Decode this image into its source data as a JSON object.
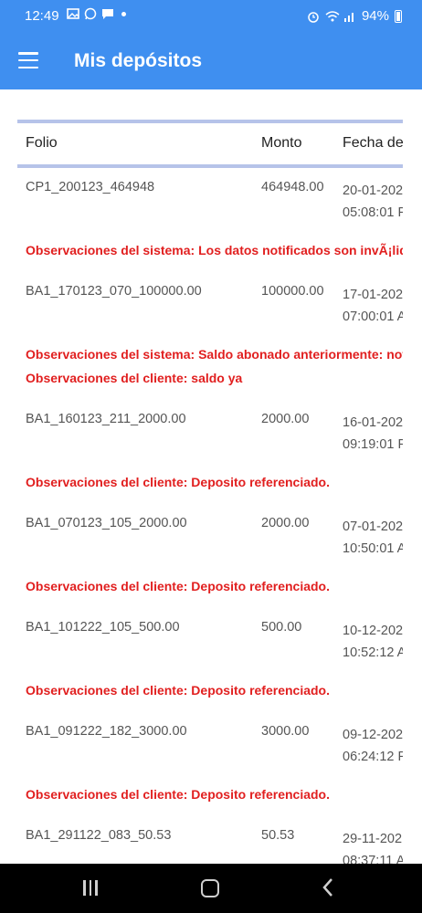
{
  "status_bar": {
    "time": "12:49",
    "battery": "94%",
    "left_icons": [
      "image-icon",
      "whatsapp-icon",
      "message-icon",
      "dot-icon"
    ],
    "right_icons": [
      "alarm-icon",
      "wifi-icon",
      "signal-icon",
      "battery-icon"
    ]
  },
  "app_bar": {
    "title": "Mis depósitos",
    "menu_icon": "hamburger-menu-icon"
  },
  "table": {
    "headers": {
      "folio": "Folio",
      "monto": "Monto",
      "fecha": "Fecha de"
    },
    "rows": [
      {
        "folio": "CP1_200123_464948",
        "monto": "464948.00",
        "fecha_line1": "20-01-202",
        "fecha_line2": "05:08:01 F",
        "obs1": "Observaciones del sistema: Los datos notificados son invÃ¡lid",
        "obs2": ""
      },
      {
        "folio": "BA1_170123_070_100000.00",
        "monto": "100000.00",
        "fecha_line1": "17-01-202",
        "fecha_line2": "07:00:01 A",
        "obs1": "Observaciones del sistema: Saldo abonado anteriormente: not",
        "obs2": "Observaciones del cliente: saldo ya"
      },
      {
        "folio": "BA1_160123_211_2000.00",
        "monto": "2000.00",
        "fecha_line1": "16-01-202",
        "fecha_line2": "09:19:01 F",
        "obs1": "Observaciones del cliente: Deposito referenciado.",
        "obs2": ""
      },
      {
        "folio": "BA1_070123_105_2000.00",
        "monto": "2000.00",
        "fecha_line1": "07-01-202",
        "fecha_line2": "10:50:01 A",
        "obs1": "Observaciones del cliente: Deposito referenciado.",
        "obs2": ""
      },
      {
        "folio": "BA1_101222_105_500.00",
        "monto": "500.00",
        "fecha_line1": "10-12-202",
        "fecha_line2": "10:52:12 A",
        "obs1": "Observaciones del cliente: Deposito referenciado.",
        "obs2": ""
      },
      {
        "folio": "BA1_091222_182_3000.00",
        "monto": "3000.00",
        "fecha_line1": "09-12-202",
        "fecha_line2": "06:24:12 F",
        "obs1": "Observaciones del cliente: Deposito referenciado.",
        "obs2": ""
      },
      {
        "folio": "BA1_291122_083_50.53",
        "monto": "50.53",
        "fecha_line1": "29-11-202",
        "fecha_line2": "08:37:11 A",
        "obs1": "",
        "obs2": ""
      }
    ]
  },
  "nav_bar": {
    "icons": [
      "recents-icon",
      "home-icon",
      "back-icon"
    ]
  },
  "colors": {
    "primary": "#3f8ff0",
    "rule": "#b6c3e9",
    "observation": "#e11f1f",
    "cell_text": "#555555"
  }
}
